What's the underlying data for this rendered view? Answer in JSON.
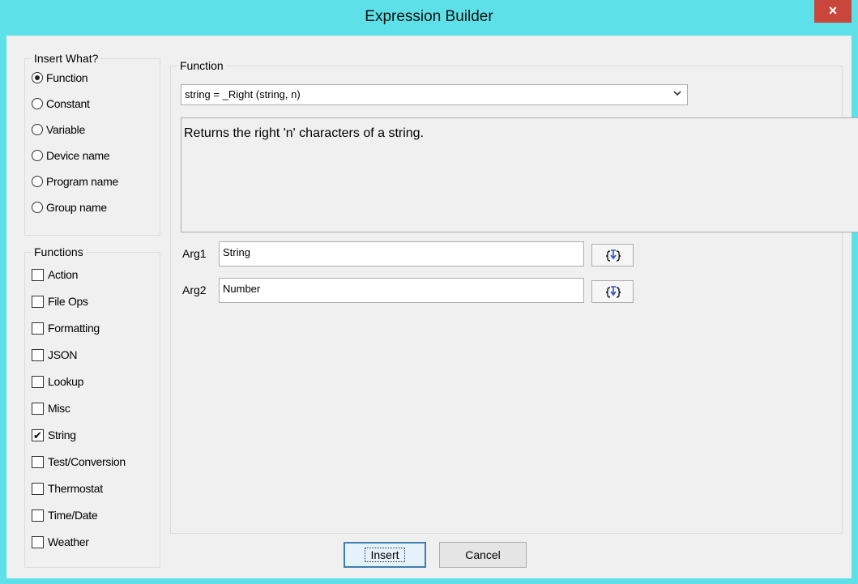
{
  "window": {
    "title": "Expression Builder",
    "close_glyph": "×"
  },
  "insert_what": {
    "legend": "Insert What?",
    "options": [
      {
        "label": "Function",
        "selected": true
      },
      {
        "label": "Constant",
        "selected": false
      },
      {
        "label": "Variable",
        "selected": false
      },
      {
        "label": "Device name",
        "selected": false
      },
      {
        "label": "Program name",
        "selected": false
      },
      {
        "label": "Group name",
        "selected": false
      }
    ]
  },
  "functions": {
    "legend": "Functions",
    "categories": [
      {
        "label": "Action",
        "checked": false
      },
      {
        "label": "File Ops",
        "checked": false
      },
      {
        "label": "Formatting",
        "checked": false
      },
      {
        "label": "JSON",
        "checked": false
      },
      {
        "label": "Lookup",
        "checked": false
      },
      {
        "label": "Misc",
        "checked": false
      },
      {
        "label": "String",
        "checked": true
      },
      {
        "label": "Test/Conversion",
        "checked": false
      },
      {
        "label": "Thermostat",
        "checked": false
      },
      {
        "label": "Time/Date",
        "checked": false
      },
      {
        "label": "Weather",
        "checked": false
      }
    ]
  },
  "function_panel": {
    "legend": "Function",
    "selected_function": "string = _Right (string, n)",
    "description": "Returns the right 'n' characters of a string.",
    "args": [
      {
        "label": "Arg1",
        "value": "String"
      },
      {
        "label": "Arg2",
        "value": "Number"
      }
    ]
  },
  "buttons": {
    "insert": "Insert",
    "cancel": "Cancel"
  },
  "icons": {
    "close": "close-icon",
    "combo": "chevron-down-icon",
    "arg_builder": "expression-icon"
  },
  "colors": {
    "titlebar": "#5ee0e8",
    "close": "#c9463d",
    "default_button_border": "#3c7fb1"
  }
}
